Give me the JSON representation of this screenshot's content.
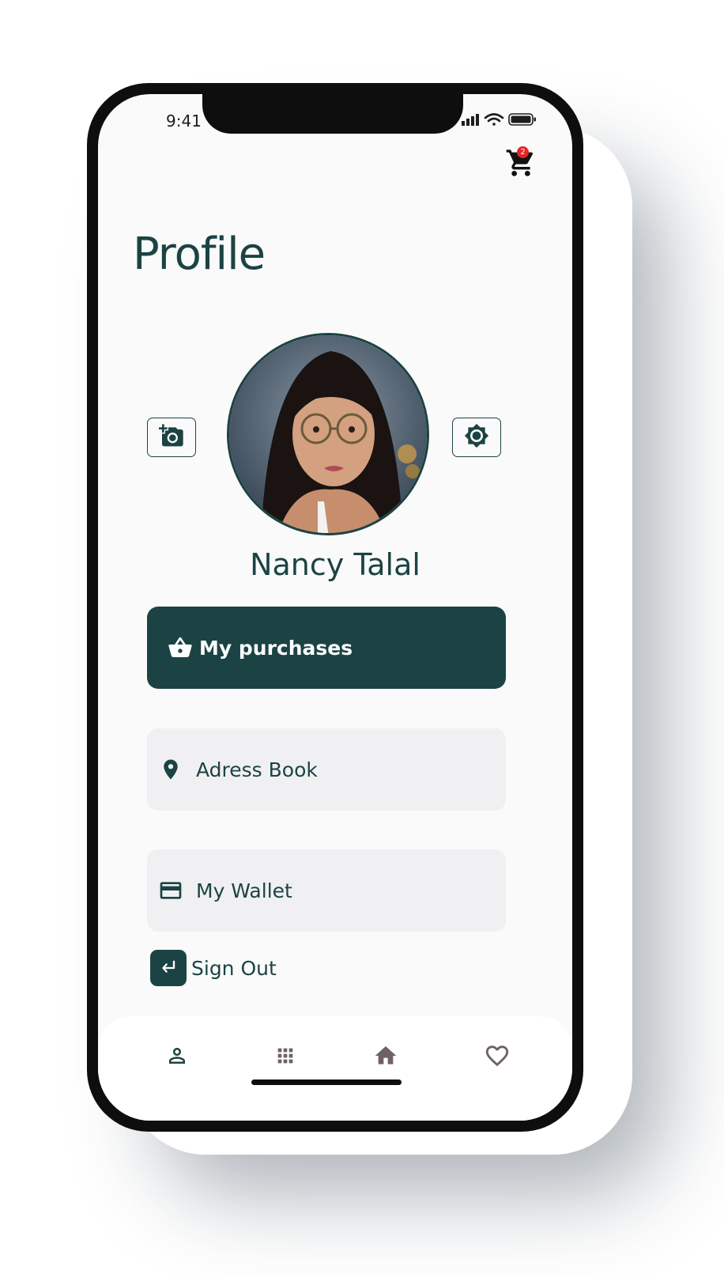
{
  "status_bar": {
    "time": "9:41",
    "icons": [
      "signal-icon",
      "wifi-icon",
      "battery-icon"
    ]
  },
  "header": {
    "cart_icon": "cart-icon",
    "cart_count": "2"
  },
  "page": {
    "title": "Profile"
  },
  "profile": {
    "name": "Nancy Talal",
    "left_button_icon": "add-photo-icon",
    "right_button_icon": "brightness-icon"
  },
  "menu": {
    "purchases": {
      "label": "My purchases",
      "icon": "basket-icon"
    },
    "address": {
      "label": "Adress Book",
      "icon": "location-pin-icon"
    },
    "wallet": {
      "label": "My Wallet",
      "icon": "credit-card-icon"
    },
    "signout": {
      "label": "Sign Out",
      "icon": "sign-out-icon"
    }
  },
  "bottom_nav": {
    "items": [
      {
        "icon": "person-icon"
      },
      {
        "icon": "grid-icon"
      },
      {
        "icon": "home-icon"
      },
      {
        "icon": "heart-icon"
      }
    ]
  },
  "colors": {
    "primary": "#1c4344",
    "background": "#fafafa",
    "card": "#f0f0f2",
    "badge": "#e62222",
    "nav_icon": "#6e6162"
  }
}
